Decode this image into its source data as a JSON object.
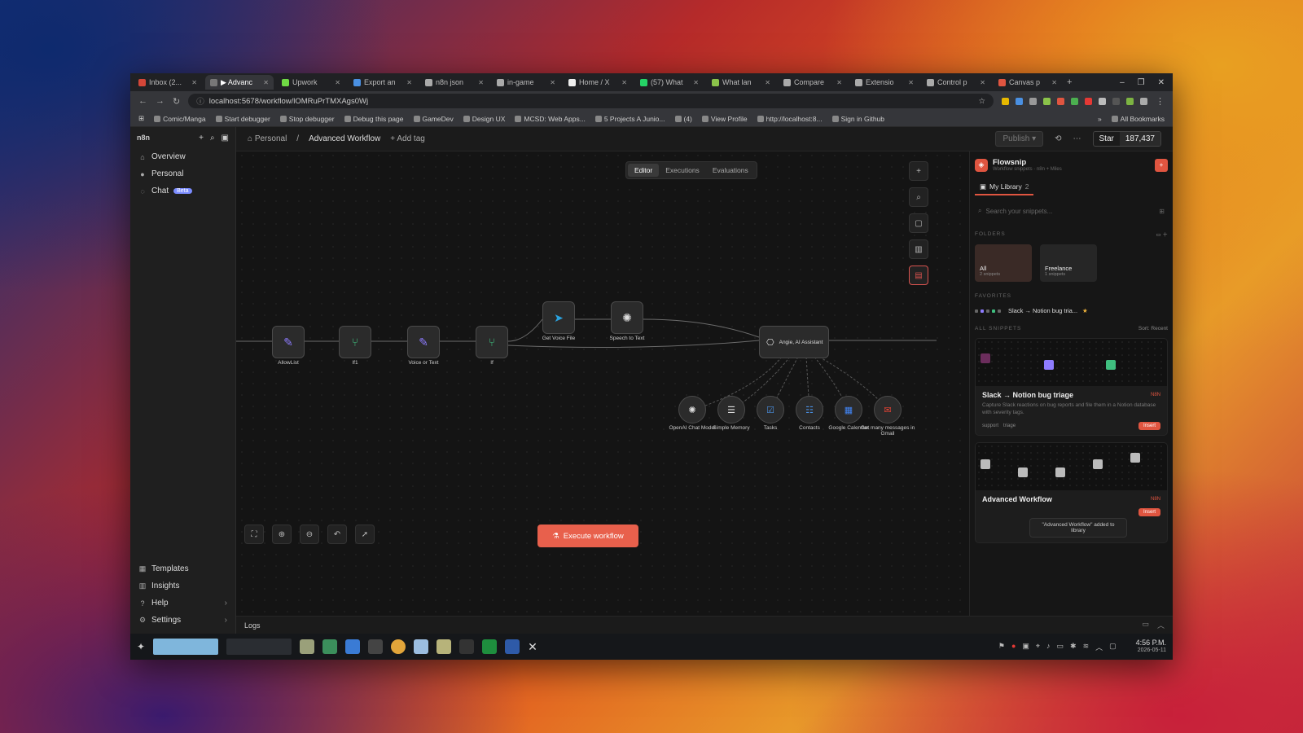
{
  "browser": {
    "tabs": [
      {
        "label": "Inbox (2...",
        "color": "#d44638",
        "active": false
      },
      {
        "label": "▶ Advanc",
        "color": "#777777",
        "active": true
      },
      {
        "label": "Upwork",
        "color": "#6fda44",
        "active": false
      },
      {
        "label": "Export an",
        "color": "#4a90e2",
        "active": false
      },
      {
        "label": "n8n json",
        "color": "#aaaaaa",
        "active": false
      },
      {
        "label": "in-game",
        "color": "#aaaaaa",
        "active": false
      },
      {
        "label": "Home / X",
        "color": "#eeeeee",
        "active": false
      },
      {
        "label": "(57) What",
        "color": "#25d366",
        "active": false
      },
      {
        "label": "What lan",
        "color": "#8bc34a",
        "active": false
      },
      {
        "label": "Compare",
        "color": "#aaaaaa",
        "active": false
      },
      {
        "label": "Extensio",
        "color": "#aaaaaa",
        "active": false
      },
      {
        "label": "Control p",
        "color": "#aaaaaa",
        "active": false
      },
      {
        "label": "Canvas p",
        "color": "#e05540",
        "active": false
      }
    ],
    "url": "localhost:5678/workflow/lOMRuPrTMXAgs0Wj",
    "bookmarks": [
      "Comic/Manga",
      "Start debugger",
      "Stop debugger",
      "Debug this page",
      "GameDev",
      "Design UX",
      "MCSD: Web Apps...",
      "5 Projects A Junio...",
      "(4)",
      "View Profile",
      "http://localhost:8...",
      "Sign in Github"
    ],
    "all_bookmarks": "All Bookmarks"
  },
  "sidebar": {
    "logo": "n8n",
    "items": [
      {
        "label": "Overview",
        "icon": "home-icon"
      },
      {
        "label": "Personal",
        "icon": "user-icon"
      },
      {
        "label": "Chat",
        "icon": "chat-icon",
        "badge": "Beta"
      }
    ],
    "bottom": [
      {
        "label": "Templates"
      },
      {
        "label": "Insights"
      },
      {
        "label": "Help"
      },
      {
        "label": "Settings"
      }
    ]
  },
  "header": {
    "project": "Personal",
    "workflow": "Advanced Workflow",
    "add_tag": "+ Add tag",
    "publish": "Publish",
    "star": "Star",
    "star_count": "187,437"
  },
  "tabs": {
    "editor": "Editor",
    "executions": "Executions",
    "evaluations": "Evaluations"
  },
  "nodes": {
    "allowlist": "AllowList",
    "if1": "If1",
    "voice_or_text": "Voice or Text",
    "if": "If",
    "get_voice": "Get Voice File",
    "stt": "Speech to Text",
    "agent": "Angie, AI Assistant",
    "tools": [
      "OpenAI Chat Model",
      "Simple Memory",
      "Tasks",
      "Contacts",
      "Google Calendar",
      "Get many messages in Gmail"
    ]
  },
  "execute": "Execute workflow",
  "logs": "Logs",
  "flowsnip": {
    "name": "Flowsnip",
    "subtitle": "Workflow snippets · n8n + Miles",
    "my_library": "My Library",
    "lib_count": "2",
    "search_placeholder": "Search your snippets...",
    "folders_label": "FOLDERS",
    "folders": [
      {
        "name": "All",
        "count": "2 snippets"
      },
      {
        "name": "Freelance",
        "count": "1 snippets"
      }
    ],
    "favorites_label": "FAVORITES",
    "favorite": "Slack → Notion bug tria...",
    "all_snippets_label": "ALL SNIPPETS",
    "sort": "Sort: Recent",
    "cards": [
      {
        "title": "Slack → Notion bug triage",
        "tag": "N8N",
        "desc": "Capture Slack reactions on bug reports and file them in a Notion database with severity tags.",
        "tags": [
          "support",
          "triage"
        ],
        "insert": "Insert"
      },
      {
        "title": "Advanced Workflow",
        "tag": "N8N",
        "insert": "Insert"
      }
    ],
    "toast": "\"Advanced Workflow\" added to library"
  },
  "taskbar": {
    "time": "4:56 P.M.",
    "date": "2026-05-11"
  }
}
